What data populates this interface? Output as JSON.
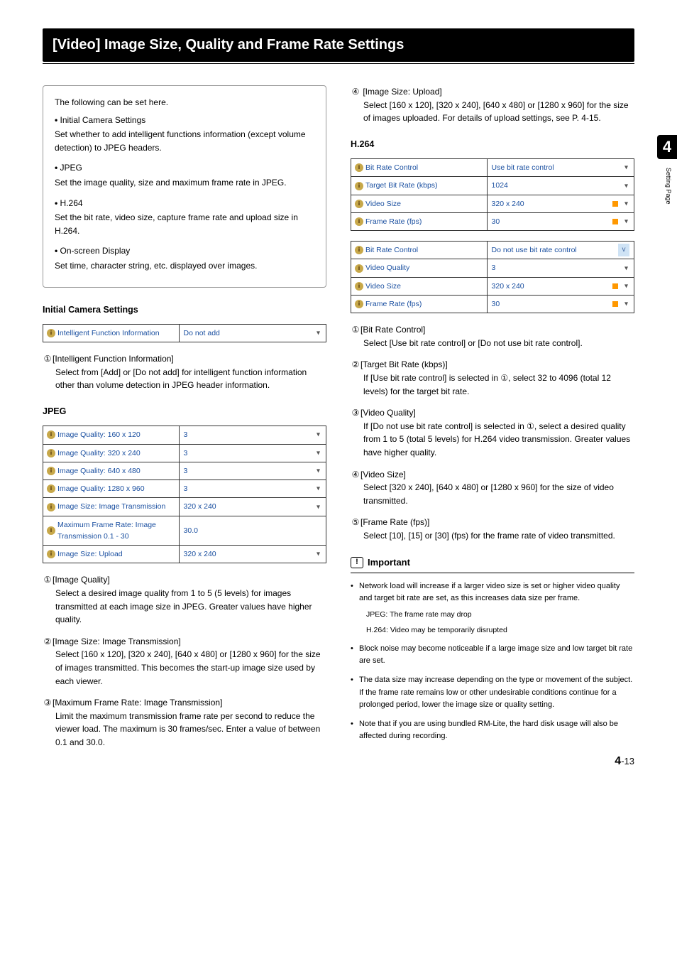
{
  "page_title": "[Video] Image Size, Quality and Frame Rate Settings",
  "side_tab_number": "4",
  "side_tab_text": "Setting Page",
  "footer": {
    "chapter": "4",
    "sep": "-",
    "page": "13"
  },
  "intro": {
    "lead": "The following can be set here.",
    "items": [
      {
        "title": "Initial Camera Settings",
        "text": "Set whether to add intelligent functions information (except volume detection) to JPEG headers."
      },
      {
        "title": "JPEG",
        "text": "Set the image quality, size and maximum frame rate in JPEG."
      },
      {
        "title": "H.264",
        "text": "Set the bit rate, video size, capture frame rate and upload size in H.264."
      },
      {
        "title": "On-screen Display",
        "text": "Set time, character string, etc. displayed over images."
      }
    ]
  },
  "initial_camera": {
    "heading": "Initial Camera Settings",
    "rows": [
      {
        "label": "Intelligent Function Information",
        "value": "Do not add",
        "chev": true
      }
    ],
    "items": [
      {
        "num": "①",
        "title": "[Intelligent Function Information]",
        "text": "Select from [Add] or [Do not add] for intelligent function information other than volume detection in JPEG header information."
      }
    ]
  },
  "jpeg": {
    "heading": "JPEG",
    "rows": [
      {
        "label": "Image Quality: 160 x 120",
        "value": "3",
        "chev": true
      },
      {
        "label": "Image Quality: 320 x 240",
        "value": "3",
        "chev": true
      },
      {
        "label": "Image Quality: 640 x 480",
        "value": "3",
        "chev": true
      },
      {
        "label": "Image Quality: 1280 x 960",
        "value": "3",
        "chev": true
      },
      {
        "label": "Image Size: Image Transmission",
        "value": "320 x 240",
        "chev": true
      },
      {
        "label": "Maximum Frame Rate: Image Transmission   0.1 - 30",
        "value": "30.0"
      },
      {
        "label": "Image Size: Upload",
        "value": "320 x 240",
        "chev": true
      }
    ],
    "items": [
      {
        "num": "①",
        "title": "[Image Quality]",
        "text": "Select a desired image quality from 1 to 5 (5 levels) for images transmitted at each image size in JPEG. Greater values have higher quality."
      },
      {
        "num": "②",
        "title": "[Image Size: Image Transmission]",
        "text": "Select [160 x 120], [320 x 240], [640 x 480] or [1280 x 960] for the size of images transmitted. This becomes the start-up image size used by each viewer."
      },
      {
        "num": "③",
        "title": "[Maximum Frame Rate: Image Transmission]",
        "text": "Limit the maximum transmission frame rate per second to reduce the viewer load. The maximum is 30 frames/sec. Enter a value of between 0.1 and 30.0."
      }
    ]
  },
  "right_top_item": {
    "num": "④",
    "title": "[Image Size: Upload]",
    "text": "Select [160 x 120], [320 x 240], [640 x 480] or [1280 x 960] for the size of images uploaded. For details of upload settings, see P. 4-15."
  },
  "h264": {
    "heading": "H.264",
    "rows1": [
      {
        "label": "Bit Rate Control",
        "value": "Use bit rate control",
        "chev": true
      },
      {
        "label": "Target Bit Rate (kbps)",
        "value": "1024",
        "chev": true
      },
      {
        "label": "Video Size",
        "value": "320 x 240",
        "chev": true,
        "sq": true
      },
      {
        "label": "Frame Rate (fps)",
        "value": "30",
        "chev": true,
        "sq": true
      }
    ],
    "rows2": [
      {
        "label": "Bit Rate Control",
        "value": "Do not use bit rate control",
        "ddb": true
      },
      {
        "label": "Video Quality",
        "value": "3",
        "chev": true
      },
      {
        "label": "Video Size",
        "value": "320 x 240",
        "chev": true,
        "sq": true
      },
      {
        "label": "Frame Rate (fps)",
        "value": "30",
        "chev": true,
        "sq": true
      }
    ],
    "items": [
      {
        "num": "①",
        "title": "[Bit Rate Control]",
        "text": "Select [Use bit rate control] or [Do not use bit rate control]."
      },
      {
        "num": "②",
        "title": "[Target Bit Rate (kbps)]",
        "text": "If [Use bit rate control] is selected in ①, select 32 to 4096 (total 12 levels) for the target bit rate."
      },
      {
        "num": "③",
        "title": "[Video Quality]",
        "text": "If [Do not use bit rate control] is selected in ①, select a desired quality from 1 to 5 (total 5 levels) for H.264 video transmission. Greater values have higher quality."
      },
      {
        "num": "④",
        "title": "[Video Size]",
        "text": "Select [320 x 240], [640 x 480] or [1280 x 960] for the size of video transmitted."
      },
      {
        "num": "⑤",
        "title": "[Frame Rate (fps)]",
        "text": "Select [10], [15] or [30] (fps) for the frame rate of video transmitted."
      }
    ]
  },
  "important": {
    "heading": "Important",
    "items": [
      {
        "text": "Network load will increase if a larger video size is set or higher video quality and target bit rate are set, as this increases data size per frame.",
        "subs": [
          "JPEG: The frame rate may drop",
          "H.264: Video may be temporarily disrupted"
        ]
      },
      {
        "text": "Block noise may become noticeable if a large image size and low target bit rate are set."
      },
      {
        "text": "The data size may increase depending on the type or movement of the subject. If the frame rate remains low or other undesirable conditions continue for a prolonged period, lower the image size or quality setting."
      },
      {
        "text": "Note that if you are using bundled RM-Lite, the hard disk usage will also be affected during recording."
      }
    ]
  }
}
